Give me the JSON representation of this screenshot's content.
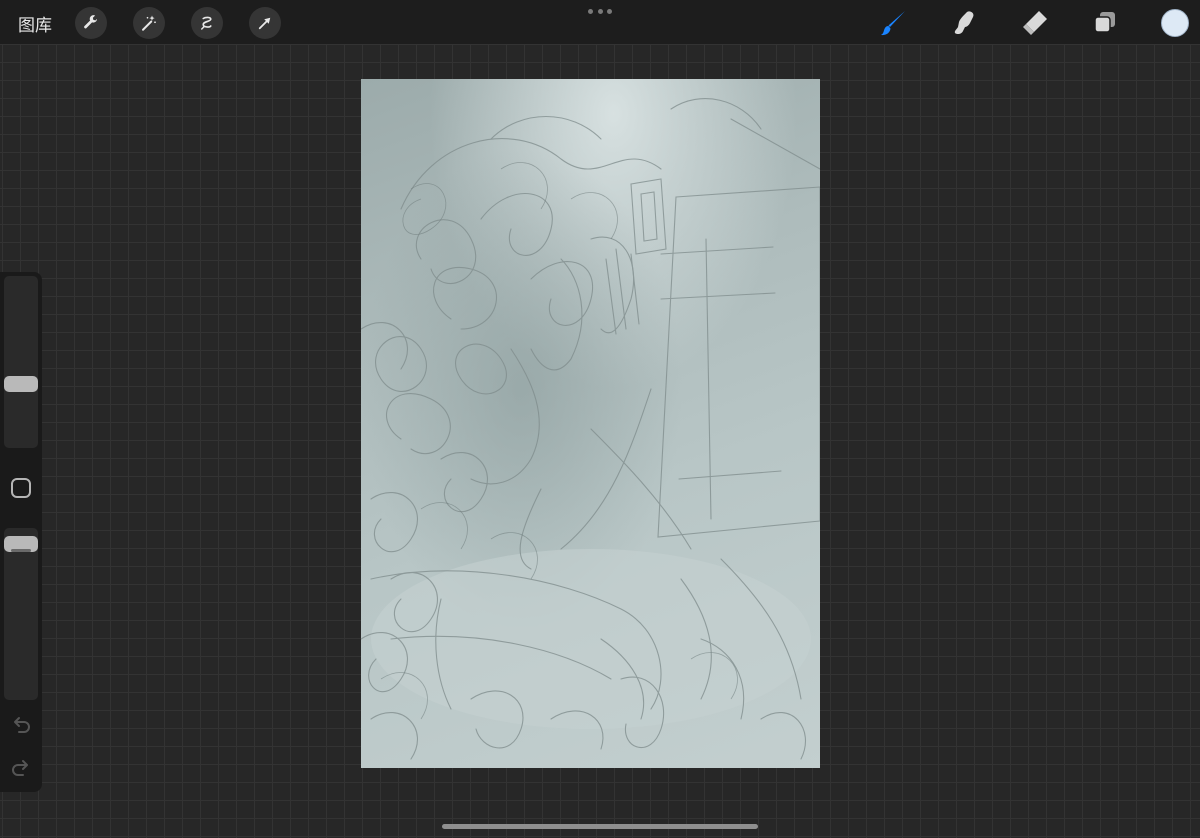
{
  "toolbar": {
    "gallery_label": "图库",
    "actions": [
      {
        "name": "wrench-icon"
      },
      {
        "name": "magic-wand-icon"
      },
      {
        "name": "selection-icon"
      },
      {
        "name": "transform-arrow-icon"
      }
    ],
    "tools": [
      {
        "name": "brush-icon",
        "active": true
      },
      {
        "name": "smudge-icon",
        "active": false
      },
      {
        "name": "eraser-icon",
        "active": false
      },
      {
        "name": "layers-icon",
        "active": false
      }
    ],
    "current_color": "#dde9f5"
  },
  "sidebar": {
    "brush_size_level": 0.36,
    "opacity_level": 0.05,
    "undo_icon": "undo-icon",
    "redo_icon": "redo-icon"
  },
  "colors": {
    "active_tool": "#1a84ff",
    "inactive_tool": "#d9d9d9",
    "canvas_bg": "#b4c2c2"
  }
}
